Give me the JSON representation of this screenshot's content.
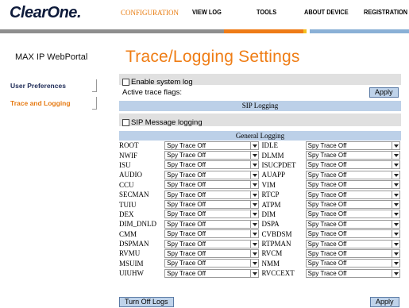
{
  "brand": {
    "logo_text": "ClearOne",
    "logo_mark": "."
  },
  "nav": {
    "items": [
      {
        "label": "CONFIGURATION",
        "active": true
      },
      {
        "label": "VIEW LOG",
        "active": false
      },
      {
        "label": "TOOLS",
        "active": false
      },
      {
        "label": "ABOUT DEVICE",
        "active": false
      },
      {
        "label": "REGISTRATION",
        "active": false
      }
    ]
  },
  "sidebar": {
    "product_name": "MAX IP WebPortal",
    "items": [
      {
        "label": "User Preferences",
        "active": false
      },
      {
        "label": "Trace and Logging",
        "active": true
      }
    ]
  },
  "page": {
    "title": "Trace/Logging Settings"
  },
  "system_log": {
    "enable_label": "Enable system log",
    "enable_checked": false,
    "active_flags_label": "Active trace flags:",
    "apply_label": "Apply"
  },
  "sip_logging": {
    "header": "SIP Logging",
    "message_logging_label": "SIP Message logging",
    "message_logging_checked": false
  },
  "general_logging": {
    "header": "General Logging",
    "rows": [
      {
        "left_module": "ROOT",
        "left_value": "Spy Trace Off",
        "right_module": "IDLE",
        "right_value": "Spy Trace Off"
      },
      {
        "left_module": "NWIF",
        "left_value": "Spy Trace Off",
        "right_module": "DLMM",
        "right_value": "Spy Trace Off"
      },
      {
        "left_module": "ISU",
        "left_value": "Spy Trace Off",
        "right_module": "ISUCPDET",
        "right_value": "Spy Trace Off"
      },
      {
        "left_module": "AUDIO",
        "left_value": "Spy Trace Off",
        "right_module": "AUAPP",
        "right_value": "Spy Trace Off"
      },
      {
        "left_module": "CCU",
        "left_value": "Spy Trace Off",
        "right_module": "VIM",
        "right_value": "Spy Trace Off"
      },
      {
        "left_module": "SECMAN",
        "left_value": "Spy Trace Off",
        "right_module": "RTCP",
        "right_value": "Spy Trace Off"
      },
      {
        "left_module": "TUIU",
        "left_value": "Spy Trace Off",
        "right_module": "ATPM",
        "right_value": "Spy Trace Off"
      },
      {
        "left_module": "DEX",
        "left_value": "Spy Trace Off",
        "right_module": "DIM",
        "right_value": "Spy Trace Off"
      },
      {
        "left_module": "DIM_DNLD",
        "left_value": "Spy Trace Off",
        "right_module": "DSPA",
        "right_value": "Spy Trace Off"
      },
      {
        "left_module": "CMM",
        "left_value": "Spy Trace Off",
        "right_module": "CVBDSM",
        "right_value": "Spy Trace Off"
      },
      {
        "left_module": "DSPMAN",
        "left_value": "Spy Trace Off",
        "right_module": "RTPMAN",
        "right_value": "Spy Trace Off"
      },
      {
        "left_module": "RVMU",
        "left_value": "Spy Trace Off",
        "right_module": "RVCM",
        "right_value": "Spy Trace Off"
      },
      {
        "left_module": "MSUIM",
        "left_value": "Spy Trace Off",
        "right_module": "NMM",
        "right_value": "Spy Trace Off"
      },
      {
        "left_module": "UIUHW",
        "left_value": "Spy Trace Off",
        "right_module": "RVCCEXT",
        "right_value": "Spy Trace Off"
      }
    ],
    "turn_off_label": "Turn Off Logs",
    "apply_label": "Apply"
  },
  "colors": {
    "accent_orange": "#ef7d15",
    "section_header_blue": "#bcd0e8",
    "row_gray": "#e0e0e0",
    "nav_bar_gray": "#8e8e8e",
    "nav_bar_blue": "#8ab0d6"
  }
}
